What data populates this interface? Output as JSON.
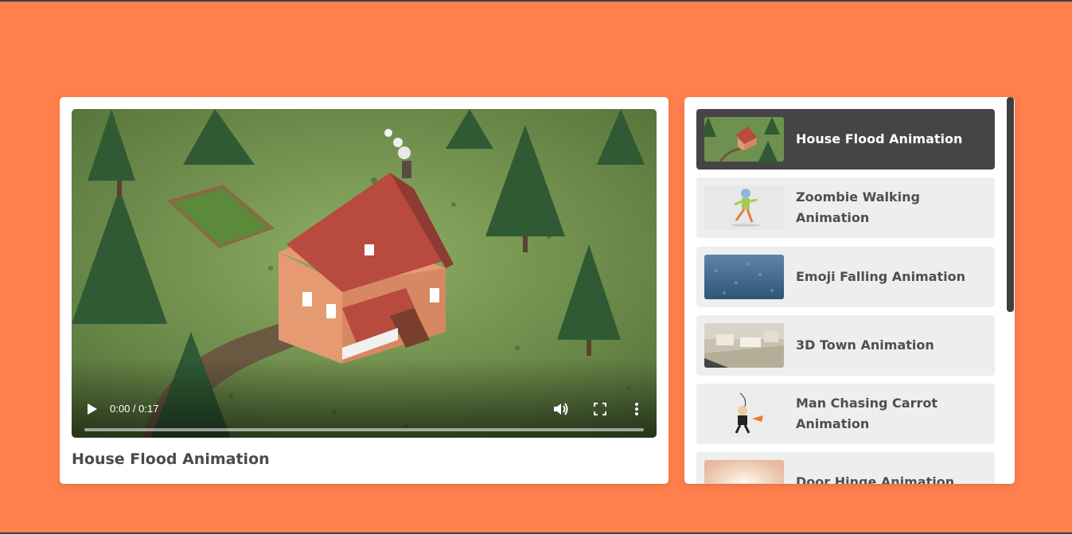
{
  "main_video": {
    "title": "House Flood Animation",
    "time_display": "0:00 / 0:17",
    "progress": 0.0
  },
  "playlist": {
    "items": [
      {
        "label": "House Flood Animation",
        "active": true,
        "thumb": "house-thumbnail"
      },
      {
        "label": "Zoombie Walking Animation",
        "active": false,
        "thumb": "zombie-thumbnail"
      },
      {
        "label": "Emoji Falling Animation",
        "active": false,
        "thumb": "water-thumbnail"
      },
      {
        "label": "3D Town Animation",
        "active": false,
        "thumb": "town-thumbnail"
      },
      {
        "label": "Man Chasing Carrot Animation",
        "active": false,
        "thumb": "man-carrot-thumbnail"
      },
      {
        "label": "Door Hinge Animation",
        "active": false,
        "thumb": "door-thumbnail"
      }
    ]
  },
  "icons": {
    "play": "play-icon",
    "volume": "volume-icon",
    "fullscreen": "fullscreen-icon",
    "more": "more-options-icon"
  },
  "colors": {
    "background": "#ff7f4d",
    "active_item": "#454545",
    "item": "#eeeeee"
  }
}
